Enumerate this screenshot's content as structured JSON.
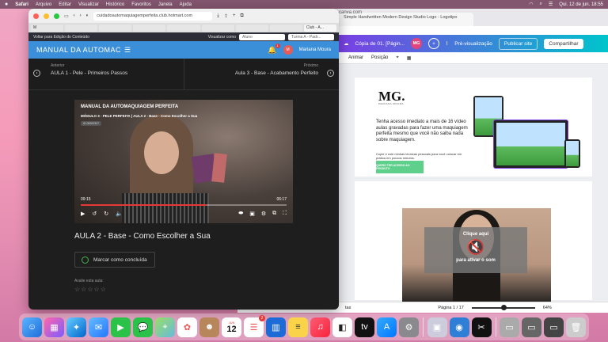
{
  "menubar": {
    "apple": "",
    "app": "Safari",
    "items": [
      "Arquivo",
      "Editar",
      "Visualizar",
      "Histórico",
      "Favoritos",
      "Janela",
      "Ajuda"
    ],
    "datetime": "Qui. 12 de jun.  18:55"
  },
  "canva": {
    "address": "canva.com",
    "tab": "Simple Handwritten Modern Design Studio Logo - Logotipo",
    "topbar": {
      "doc_title": "Cópia de 01. [Págin...",
      "avatar": "MG",
      "preview": "Pré-visualização",
      "publish": "Publicar site",
      "share": "Compartilhar"
    },
    "tools": [
      "Animar",
      "Posição"
    ],
    "page": {
      "logo": "MG.",
      "logo_sub": "MARIANA MOURA",
      "headline": "Tenha acesso imediato a mais de 16 vídeo aulas gravadas para fazer uma maquiagem perfeita mesmo que você não saiba nada sobre maquiagem.",
      "sub": "Copie e cole minhas técnicas pessoais para você colocar em prática em poucos minutos.",
      "cta": "QUERO TER ACESSO AO PRODUTO",
      "click_here": "Clique aqui",
      "activate_sound": "para ativar o som"
    },
    "footer": {
      "notes": "tas",
      "page": "Página 1 / 17",
      "zoom": "64%",
      "zoom_level": 0.5
    }
  },
  "safari": {
    "address": "cuidadoautomaquiagemperfeita.club.hotmart.com",
    "tabs": [
      "M",
      "",
      "",
      "",
      "",
      "",
      "",
      "",
      "Club - A..."
    ],
    "hotmart": {
      "back": "Voltar para Edição do Conteúdo",
      "view_as_label": "Visualizar como",
      "view_as_value": "Aluno",
      "class_value": "Turma A - Padr...",
      "course_title": "MANUAL DA AUTOMAC",
      "notif_count": "1",
      "user_initial": "M",
      "user_name": "Mariana Moura",
      "prev_label": "Anterior",
      "prev_name": "AULA 1 - Pele - Primeiros Passos",
      "next_label": "Próximo",
      "next_name": "Aula 3 - Base - Acabamento Perfeito",
      "video": {
        "title": "MANUAL DA AUTOMAQUIAGEM PERFEITA",
        "subtitle": "MÓDULO 3 - PELE PERFEITA | AULA 2 - Base - Como Escolher a Sua",
        "chip": "ID 00003337",
        "time_current": "09:15",
        "time_total": "06:17",
        "progress": 0.61
      },
      "lesson_title": "AULA 2 - Base - Como Escolher a Sua",
      "mark_done": "Marcar como concluída",
      "rate_label": "Avalie esta aula:",
      "stars": "☆☆☆☆☆"
    }
  },
  "dock": {
    "calendar_month": "JUN",
    "calendar_day": "12",
    "reminders_badge": "2"
  }
}
